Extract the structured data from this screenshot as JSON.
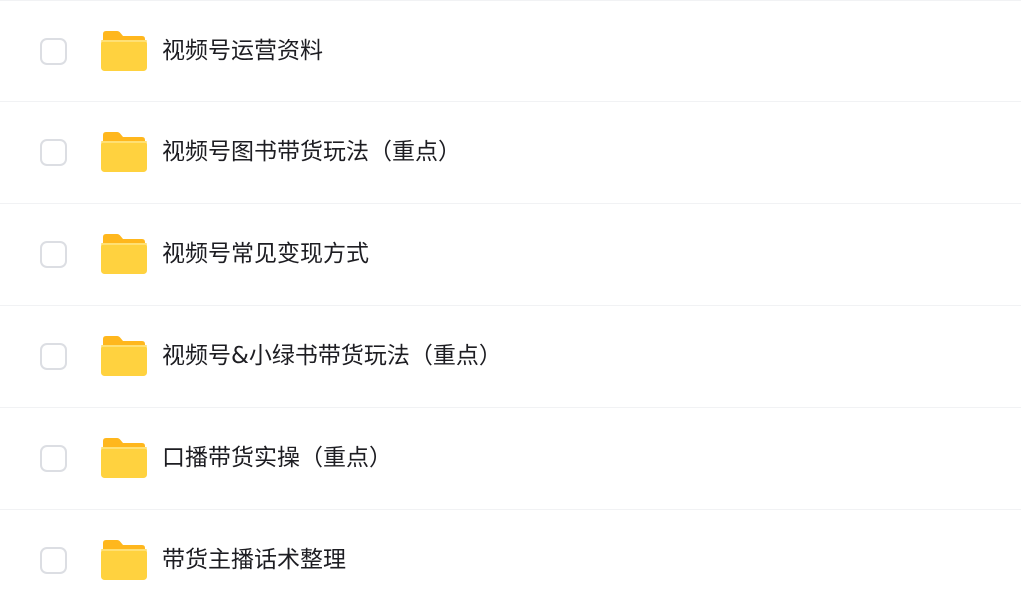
{
  "colors": {
    "folder_body": "#FFD23F",
    "folder_back": "#FFB71D",
    "checkbox_border": "#DCDEE3",
    "row_divider": "#F1F2F4",
    "text": "#1D1D22"
  },
  "icons": {
    "folder": "folder-icon",
    "checkbox": "checkbox-unchecked"
  },
  "files": [
    {
      "name": "视频号运营资料",
      "checked": false
    },
    {
      "name": "视频号图书带货玩法（重点）",
      "checked": false
    },
    {
      "name": "视频号常见变现方式",
      "checked": false
    },
    {
      "name": "视频号&小绿书带货玩法（重点）",
      "checked": false
    },
    {
      "name": "口播带货实操（重点）",
      "checked": false
    },
    {
      "name": "带货主播话术整理",
      "checked": false
    }
  ]
}
